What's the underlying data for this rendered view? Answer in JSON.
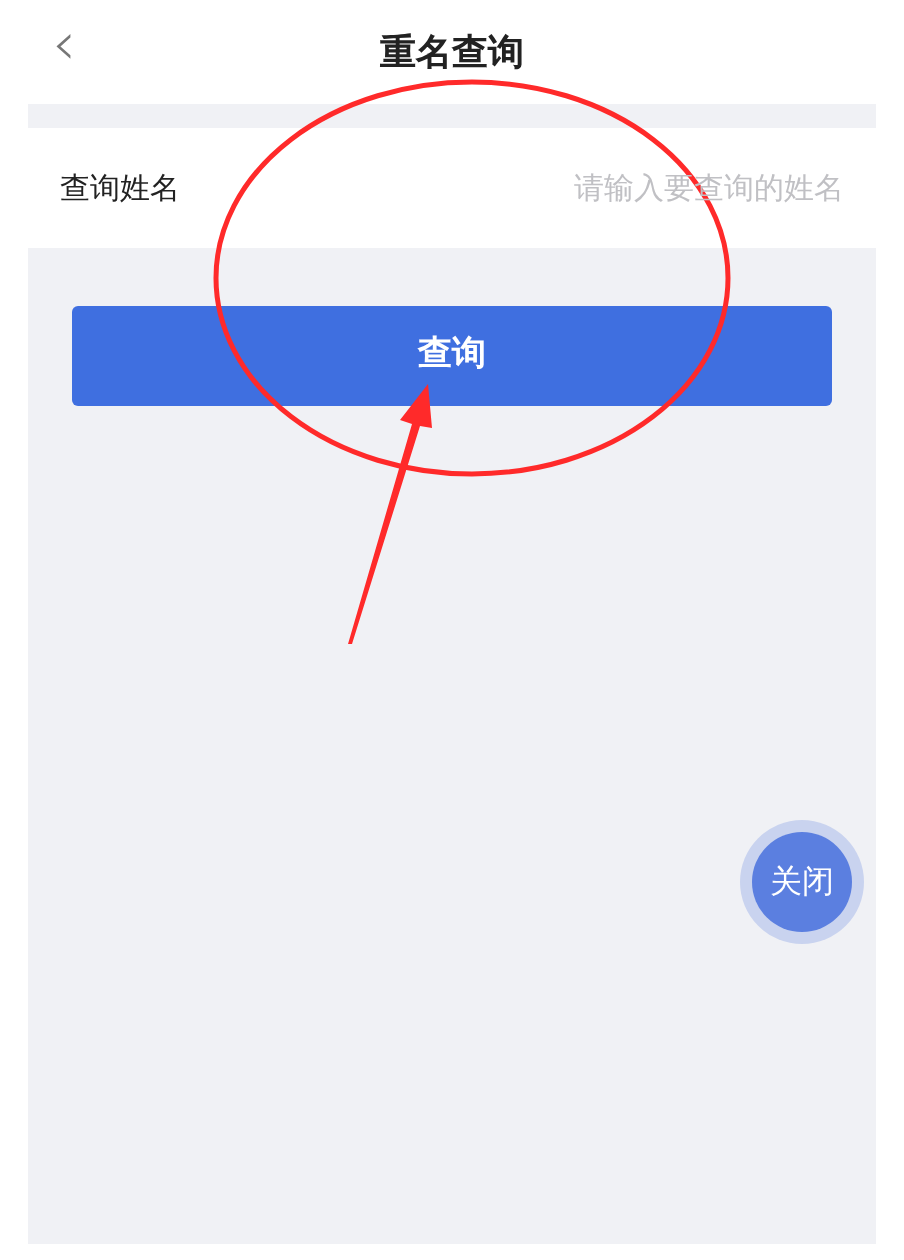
{
  "header": {
    "back_icon": "‹",
    "title": "重名查询"
  },
  "form": {
    "label": "查询姓名",
    "placeholder": "请输入要查询的姓名"
  },
  "query_button": "查询",
  "close_button": "关闭"
}
